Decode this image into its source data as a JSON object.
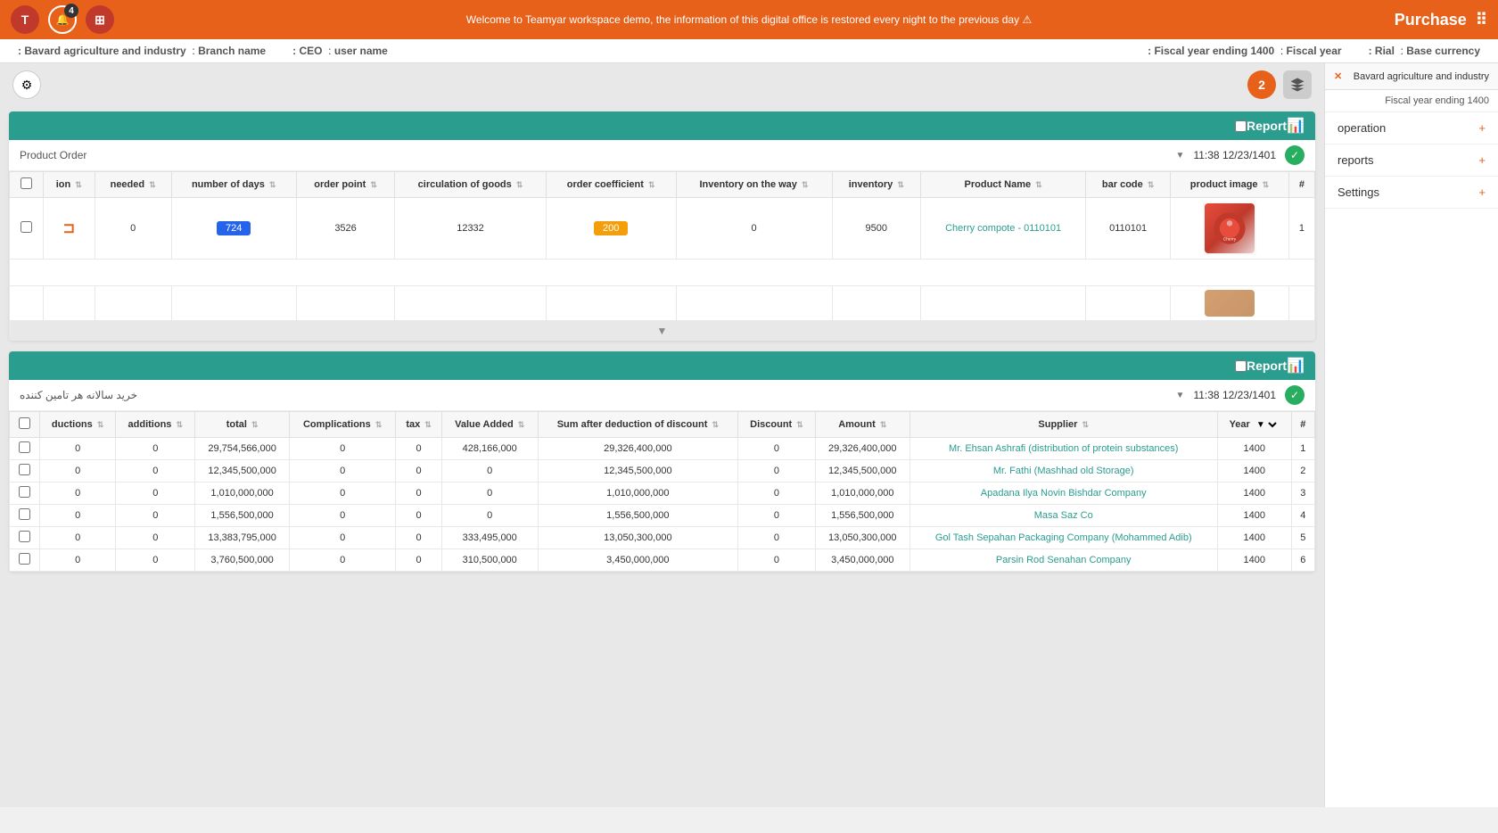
{
  "topbar": {
    "notice": "Welcome to Teamyar workspace demo, the information of this digital office is restored every night to the previous day ⚠",
    "title": "Purchase",
    "notif_count": "4"
  },
  "infobar": {
    "base_currency_label": "Base currency :",
    "base_currency_value": "Rial",
    "fiscal_year_label": "Fiscal year :",
    "fiscal_year_value": "Fiscal year ending 1400",
    "username_label": "user name :",
    "username_value": "CEO",
    "branch_label": "Branch name :",
    "branch_value": "Bavard agriculture and industry"
  },
  "sidebar": {
    "company_name": "Bavard agriculture and industry",
    "fiscal_year": "Fiscal year ending 1400",
    "items": [
      {
        "label": "operation",
        "has_plus": true
      },
      {
        "label": "reports",
        "has_plus": true
      },
      {
        "label": "Settings",
        "has_plus": true
      }
    ]
  },
  "report1": {
    "header_title": "Report",
    "sub_title": "Product Order",
    "timestamp": "12/23/1401 11:38",
    "columns": [
      "ion",
      "needed",
      "number of days",
      "order point",
      "circulation of goods",
      "order coefficient",
      "Inventory on the way",
      "inventory",
      "Product Name",
      "bar code",
      "product image",
      "#"
    ],
    "rows": [
      {
        "ion": "⊐",
        "needed": "0",
        "number_of_days": "724",
        "order_point": "3526",
        "circulation_goods": "12332",
        "order_coefficient": "200",
        "inventory_on_way": "0",
        "inventory": "9500",
        "product_name": "Cherry compote - 0110101",
        "bar_code": "0110101",
        "num": "1"
      }
    ]
  },
  "report2": {
    "header_title": "Report",
    "sub_title": "خرید سالانه هر تامین کننده",
    "timestamp": "12/23/1401 11:38",
    "columns": [
      "ductions",
      "additions",
      "total",
      "Complications",
      "tax",
      "Value Added",
      "Sum after deduction of discount",
      "Discount",
      "Amount",
      "Supplier",
      "Year",
      "#"
    ],
    "rows": [
      {
        "ductions": "0",
        "additions": "0",
        "total": "29,754,566,000",
        "complications": "0",
        "tax": "0",
        "value_added": "428,166,000",
        "sum_after": "29,326,400,000",
        "discount": "0",
        "amount": "29,326,400,000",
        "supplier": "Mr. Ehsan Ashrafi (distribution of protein substances)",
        "year": "1400",
        "num": "1"
      },
      {
        "ductions": "0",
        "additions": "0",
        "total": "12,345,500,000",
        "complications": "0",
        "tax": "0",
        "value_added": "0",
        "sum_after": "12,345,500,000",
        "discount": "0",
        "amount": "12,345,500,000",
        "supplier": "Mr. Fathi (Mashhad old Storage)",
        "year": "1400",
        "num": "2"
      },
      {
        "ductions": "0",
        "additions": "0",
        "total": "1,010,000,000",
        "complications": "0",
        "tax": "0",
        "value_added": "0",
        "sum_after": "1,010,000,000",
        "discount": "0",
        "amount": "1,010,000,000",
        "supplier": "Apadana Ilya Novin Bishdar Company",
        "year": "1400",
        "num": "3"
      },
      {
        "ductions": "0",
        "additions": "0",
        "total": "1,556,500,000",
        "complications": "0",
        "tax": "0",
        "value_added": "0",
        "sum_after": "1,556,500,000",
        "discount": "0",
        "amount": "1,556,500,000",
        "supplier": "Masa Saz Co",
        "year": "1400",
        "num": "4"
      },
      {
        "ductions": "0",
        "additions": "0",
        "total": "13,383,795,000",
        "complications": "0",
        "tax": "0",
        "value_added": "333,495,000",
        "sum_after": "13,050,300,000",
        "discount": "0",
        "amount": "13,050,300,000",
        "supplier": "Gol Tash Sepahan Packaging Company (Mohammed Adib)",
        "year": "1400",
        "num": "5"
      },
      {
        "ductions": "0",
        "additions": "0",
        "total": "3,760,500,000",
        "complications": "0",
        "tax": "0",
        "value_added": "310,500,000",
        "sum_after": "3,450,000,000",
        "discount": "0",
        "amount": "3,450,000,000",
        "supplier": "Parsin Rod Senahan Company",
        "year": "1400",
        "num": "6"
      }
    ]
  }
}
